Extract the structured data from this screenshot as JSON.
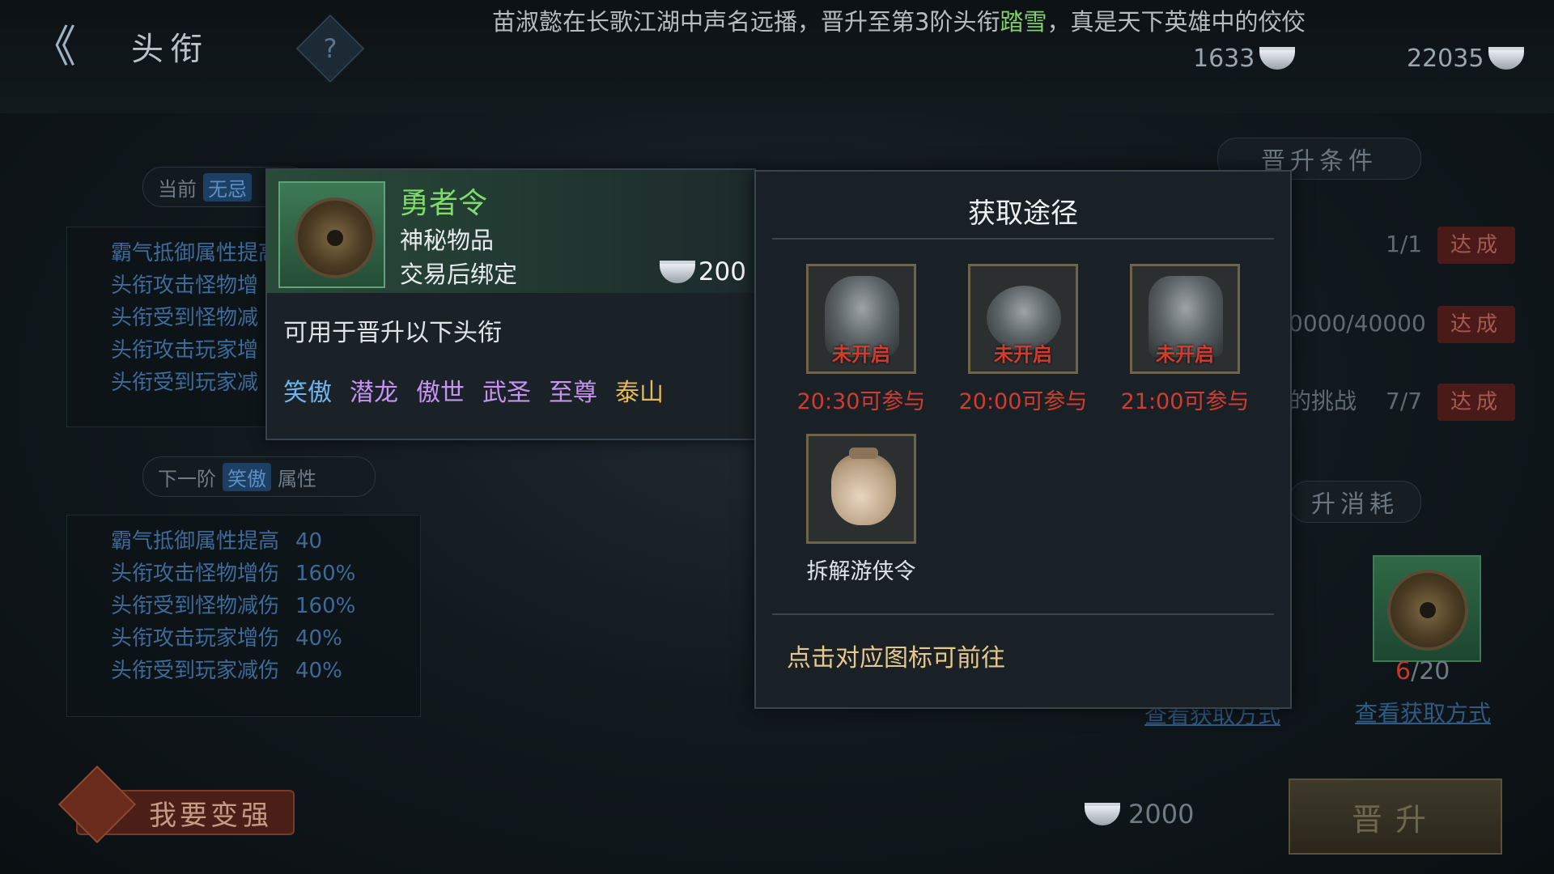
{
  "header": {
    "back_label": "《",
    "title": "头衔",
    "help_label": "?",
    "marquee_pre": "苗淑懿在长歌江湖中声名远播，晋升至第3阶头衔",
    "marquee_hl": "踏雪",
    "marquee_post": "，真是天下英雄中的佼佼",
    "silver": "1633",
    "silver_bag": "22035"
  },
  "left": {
    "current_label": "当前",
    "current_title": "无忌",
    "current_stats": [
      "霸气抵御属性提高",
      "头衔攻击怪物增",
      "头衔受到怪物减",
      "头衔攻击玩家增",
      "头衔受到玩家减"
    ],
    "next_label": "下一阶",
    "next_title": "笑傲",
    "next_suffix": "属性",
    "next_stats": [
      {
        "name": "霸气抵御属性提高",
        "value": "40"
      },
      {
        "name": "头衔攻击怪物增伤",
        "value": "160%"
      },
      {
        "name": "头衔受到怪物减伤",
        "value": "160%"
      },
      {
        "name": "头衔攻击玩家增伤",
        "value": "40%"
      },
      {
        "name": "头衔受到玩家减伤",
        "value": "40%"
      }
    ]
  },
  "right": {
    "conditions_title": "晋升条件",
    "req1": "1/1",
    "req2": "0000/40000",
    "req3_label": "的挑战",
    "req3": "7/7",
    "done_label": "达成",
    "consume_title": "升消耗",
    "item_have": "6",
    "item_need": "/20",
    "link1": "查看获取方式",
    "link2": "查看获取方式"
  },
  "bottom": {
    "strong_label": "我要变强",
    "cost": "2000",
    "upgrade_label": "晋升"
  },
  "tooltip": {
    "name": "勇者令",
    "type": "神秘物品",
    "bind": "交易后绑定",
    "price": "200",
    "desc": "可用于晋升以下头衔",
    "titles": [
      {
        "label": "笑傲",
        "color": "#6fb4f0"
      },
      {
        "label": "潜龙",
        "color": "#c693f2"
      },
      {
        "label": "傲世",
        "color": "#c693f2"
      },
      {
        "label": "武圣",
        "color": "#c693f2"
      },
      {
        "label": "至尊",
        "color": "#c693f2"
      },
      {
        "label": "泰山",
        "color": "#e6b85c"
      }
    ]
  },
  "source": {
    "title": "获取途径",
    "locked_label": "未开启",
    "items": [
      {
        "time": "20:30可参与",
        "icon": "swordsman-icon"
      },
      {
        "time": "20:00可参与",
        "icon": "drum-icon"
      },
      {
        "time": "21:00可参与",
        "icon": "dragon-chest-icon"
      }
    ],
    "dismantle_label": "拆解游侠令",
    "hint": "点击对应图标可前往"
  }
}
